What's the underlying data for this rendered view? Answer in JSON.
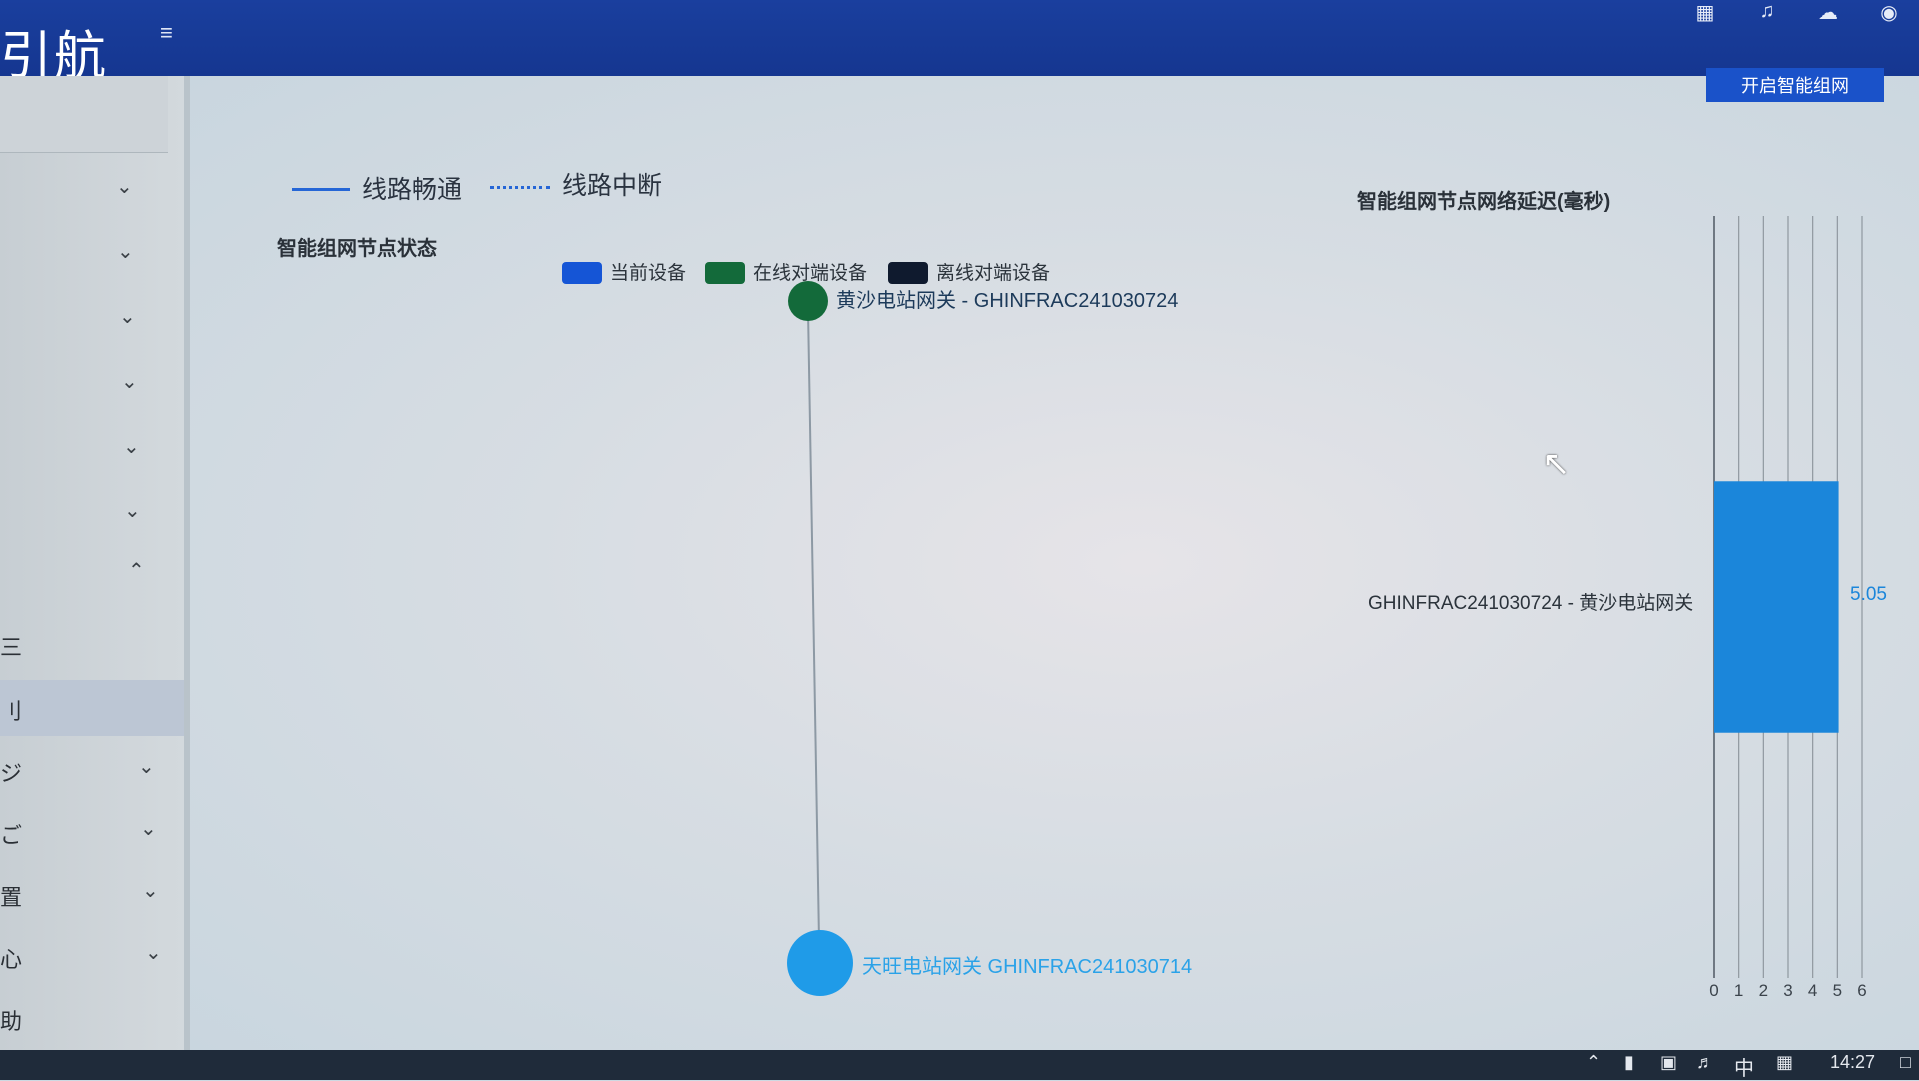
{
  "header": {
    "logo_text": "引航",
    "menu_icon": "hamburger-icon",
    "icons": [
      "qr-icon",
      "bell-icon",
      "cloud-icon",
      "globe-icon"
    ]
  },
  "sidebar": {
    "items": [
      {
        "label": "",
        "state": "collapsed"
      },
      {
        "label": "",
        "state": "collapsed"
      },
      {
        "label": "",
        "state": "collapsed"
      },
      {
        "label": "",
        "state": "collapsed"
      },
      {
        "label": "",
        "state": "collapsed"
      },
      {
        "label": "",
        "state": "collapsed"
      },
      {
        "label": "",
        "state": "expanded"
      },
      {
        "label": "三",
        "state": "child"
      },
      {
        "label": "刂",
        "state": "child-active"
      },
      {
        "label": "ジ",
        "state": "collapsed"
      },
      {
        "label": "ご",
        "state": "collapsed"
      },
      {
        "label": "置",
        "state": "collapsed"
      },
      {
        "label": "心",
        "state": "collapsed"
      },
      {
        "label": "助",
        "state": "none"
      }
    ]
  },
  "main": {
    "smart_network_button": "开启智能组网",
    "line_legend": {
      "solid": "线路畅通",
      "dotted": "线路中断"
    },
    "node_status_title": "智能组网节点状态",
    "device_legend": [
      {
        "label": "当前设备",
        "color": "#1555d6"
      },
      {
        "label": "在线对端设备",
        "color": "#136a3a"
      },
      {
        "label": "离线对端设备",
        "color": "#0f1a2e"
      }
    ],
    "nodes": [
      {
        "label": "黄沙电站网关 - GHINFRAC241030724",
        "color": "#136a3a",
        "label_color": "#1c3a5a"
      },
      {
        "label": "天旺电站网关 GHINFRAC241030714",
        "color": "#1f9be8",
        "label_color": "#2aa2e8"
      }
    ],
    "latency_title": "智能组网节点网络延迟(毫秒)"
  },
  "chart_data": {
    "type": "bar",
    "orientation": "horizontal",
    "title": "智能组网节点网络延迟(毫秒)",
    "categories": [
      "GHINFRAC241030724 - 黄沙电站网关"
    ],
    "values": [
      5.05
    ],
    "data_labels": [
      "5.05"
    ],
    "x_ticks": [
      "0",
      "1",
      "2",
      "3",
      "4",
      "5",
      "6"
    ],
    "xlim": [
      0,
      6
    ],
    "grid": true,
    "bar_color": "#1b86da"
  },
  "taskbar": {
    "ime": "中",
    "time": "14:27"
  }
}
